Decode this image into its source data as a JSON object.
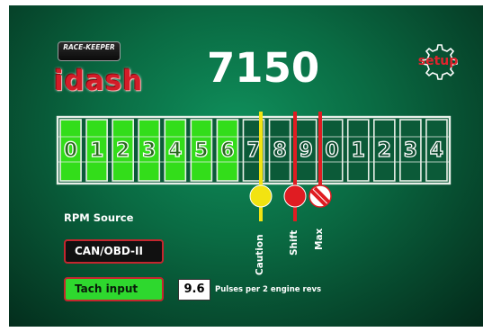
{
  "logo": {
    "top_text": "RACE-KEEPER",
    "wordmark": "idash"
  },
  "rpm": {
    "value": "7150"
  },
  "setup": {
    "label": "setup",
    "icon": "gear-icon"
  },
  "tach": {
    "ticks": [
      "0",
      "1",
      "2",
      "3",
      "4",
      "5",
      "6",
      "7",
      "8",
      "9",
      "0",
      "1",
      "2",
      "3",
      "4"
    ],
    "lit_segments": 7,
    "colors": {
      "lit": "#33dd1a",
      "outline": "#e8efe8",
      "unlit": "#0b5a38"
    },
    "markers": [
      {
        "id": "caution",
        "label": "Caution",
        "color": "#f2e311",
        "style": "solid"
      },
      {
        "id": "shift",
        "label": "Shift",
        "color": "#e01c22",
        "style": "solid"
      },
      {
        "id": "max",
        "label": "Max",
        "color": "#e01c22",
        "style": "striped"
      }
    ]
  },
  "rpm_source": {
    "title": "RPM Source",
    "options": [
      {
        "label": "CAN/OBD-II",
        "selected": false
      },
      {
        "label": "Tach input",
        "selected": true
      }
    ]
  },
  "pulses": {
    "value": "9.6",
    "description": "Pulses per 2 engine revs"
  }
}
